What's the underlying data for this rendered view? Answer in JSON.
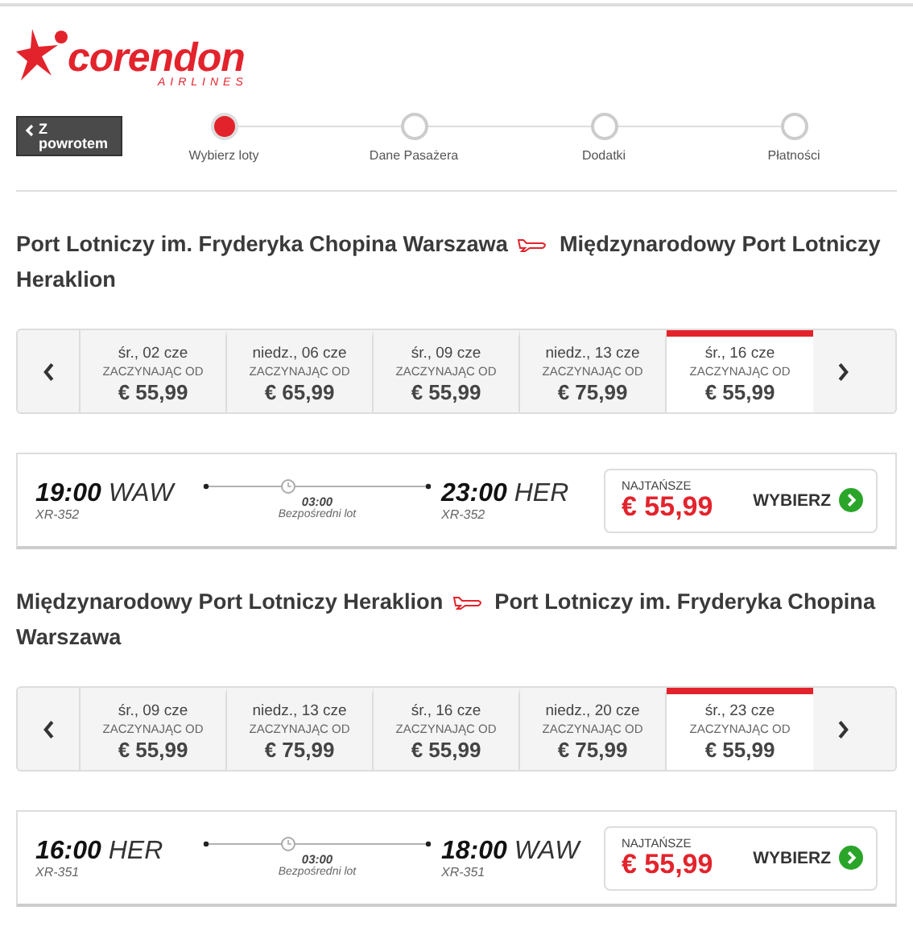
{
  "logo": {
    "name": "corendon",
    "tagline": "AIRLINES"
  },
  "back_button": {
    "label": "Z powrotem"
  },
  "steps": [
    {
      "label": "Wybierz loty",
      "selected": true
    },
    {
      "label": "Dane Pasażera",
      "selected": false
    },
    {
      "label": "Dodatki",
      "selected": false
    },
    {
      "label": "Płatności",
      "selected": false
    }
  ],
  "routes": [
    {
      "origin": "Port Lotniczy im. Fryderyka Chopina Warszawa",
      "destination": "Międzynarodowy Port Lotniczy Heraklion",
      "dates": [
        {
          "date": "śr., 02 cze",
          "caption": "ZACZYNAJĄC OD",
          "price": "€ 55,99",
          "selected": false
        },
        {
          "date": "niedz., 06 cze",
          "caption": "ZACZYNAJĄC OD",
          "price": "€ 65,99",
          "selected": false
        },
        {
          "date": "śr., 09 cze",
          "caption": "ZACZYNAJĄC OD",
          "price": "€ 55,99",
          "selected": false
        },
        {
          "date": "niedz., 13 cze",
          "caption": "ZACZYNAJĄC OD",
          "price": "€ 75,99",
          "selected": false
        },
        {
          "date": "śr., 16 cze",
          "caption": "ZACZYNAJĄC OD",
          "price": "€ 55,99",
          "selected": true
        }
      ],
      "flight": {
        "depart_time": "19:00",
        "depart_code": "WAW",
        "depart_number": "XR-352",
        "duration": "03:00",
        "type": "Bezpośredni lot",
        "arrive_time": "23:00",
        "arrive_code": "HER",
        "arrive_number": "XR-352",
        "price_label": "NAJTAŃSZE",
        "price": "€ 55,99",
        "button": "WYBIERZ"
      }
    },
    {
      "origin": "Międzynarodowy Port Lotniczy Heraklion",
      "destination": "Port Lotniczy im. Fryderyka Chopina Warszawa",
      "dates": [
        {
          "date": "śr., 09 cze",
          "caption": "ZACZYNAJĄC OD",
          "price": "€ 55,99",
          "selected": false
        },
        {
          "date": "niedz., 13 cze",
          "caption": "ZACZYNAJĄC OD",
          "price": "€ 75,99",
          "selected": false
        },
        {
          "date": "śr., 16 cze",
          "caption": "ZACZYNAJĄC OD",
          "price": "€ 55,99",
          "selected": false
        },
        {
          "date": "niedz., 20 cze",
          "caption": "ZACZYNAJĄC OD",
          "price": "€ 75,99",
          "selected": false
        },
        {
          "date": "śr., 23 cze",
          "caption": "ZACZYNAJĄC OD",
          "price": "€ 55,99",
          "selected": true
        }
      ],
      "flight": {
        "depart_time": "16:00",
        "depart_code": "HER",
        "depart_number": "XR-351",
        "duration": "03:00",
        "type": "Bezpośredni lot",
        "arrive_time": "18:00",
        "arrive_code": "WAW",
        "arrive_number": "XR-351",
        "price_label": "NAJTAŃSZE",
        "price": "€ 55,99",
        "button": "WYBIERZ"
      }
    }
  ]
}
